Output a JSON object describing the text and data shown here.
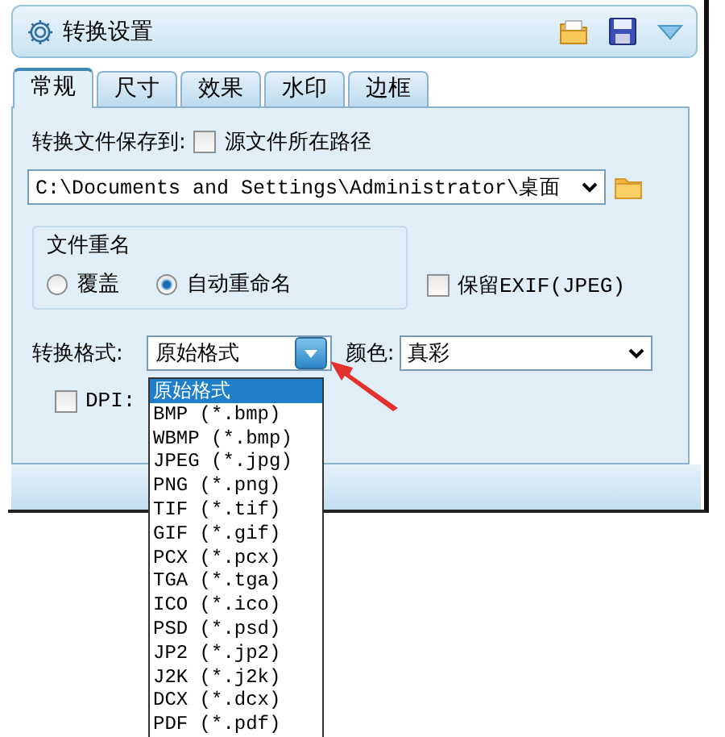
{
  "window": {
    "title": "转换设置"
  },
  "tabs": [
    {
      "label": "常规",
      "selected": true
    },
    {
      "label": "尺寸",
      "selected": false
    },
    {
      "label": "效果",
      "selected": false
    },
    {
      "label": "水印",
      "selected": false
    },
    {
      "label": "边框",
      "selected": false
    }
  ],
  "save_to": {
    "label": "转换文件保存到:",
    "source_path": {
      "label": "源文件所在路径",
      "checked": false
    },
    "path": "C:\\Documents and Settings\\Administrator\\桌面"
  },
  "rename": {
    "title": "文件重名",
    "options": [
      {
        "label": "覆盖",
        "selected": false
      },
      {
        "label": "自动重命名",
        "selected": true
      }
    ]
  },
  "keep_exif": {
    "label": "保留EXIF(JPEG)",
    "checked": false
  },
  "format": {
    "label": "转换格式:",
    "value": "原始格式",
    "options": [
      {
        "label": "原始格式",
        "selected": true
      },
      {
        "label": "BMP (*.bmp)",
        "selected": false
      },
      {
        "label": "WBMP (*.bmp)",
        "selected": false
      },
      {
        "label": "JPEG (*.jpg)",
        "selected": false
      },
      {
        "label": "PNG (*.png)",
        "selected": false
      },
      {
        "label": "TIF (*.tif)",
        "selected": false
      },
      {
        "label": "GIF (*.gif)",
        "selected": false
      },
      {
        "label": "PCX (*.pcx)",
        "selected": false
      },
      {
        "label": "TGA (*.tga)",
        "selected": false
      },
      {
        "label": "ICO (*.ico)",
        "selected": false
      },
      {
        "label": "PSD (*.psd)",
        "selected": false
      },
      {
        "label": "JP2 (*.jp2)",
        "selected": false
      },
      {
        "label": "J2K (*.j2k)",
        "selected": false
      },
      {
        "label": "DCX (*.dcx)",
        "selected": false
      },
      {
        "label": "PDF (*.pdf)",
        "selected": false
      }
    ]
  },
  "color": {
    "label": "颜色:",
    "value": "真彩"
  },
  "dpi": {
    "label": "DPI:",
    "checked": false
  }
}
